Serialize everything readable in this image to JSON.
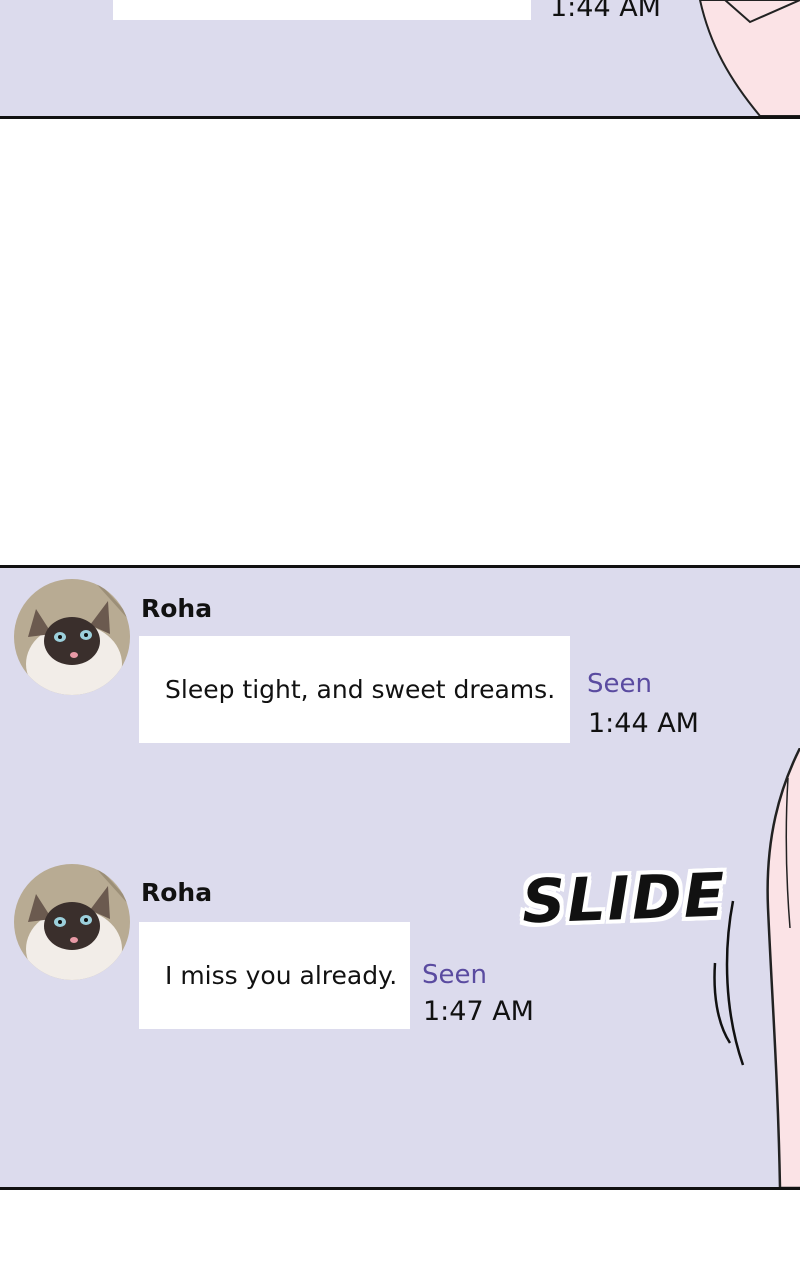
{
  "top_panel": {
    "timestamp": "1:44 AM"
  },
  "messages": [
    {
      "sender": "Roha",
      "text": "Sleep tight, and sweet dreams.",
      "status": "Seen",
      "time": "1:44 AM"
    },
    {
      "sender": "Roha",
      "text": "I miss you already.",
      "status": "Seen",
      "time": "1:47 AM"
    }
  ],
  "sound_effect": "SLIDE",
  "colors": {
    "chat_background": "#dcdbed",
    "bubble": "#ffffff",
    "seen_text": "#5a4ba0",
    "skin": "#fbe3e6"
  },
  "icons": {
    "avatar": "siamese-cat-avatar"
  }
}
